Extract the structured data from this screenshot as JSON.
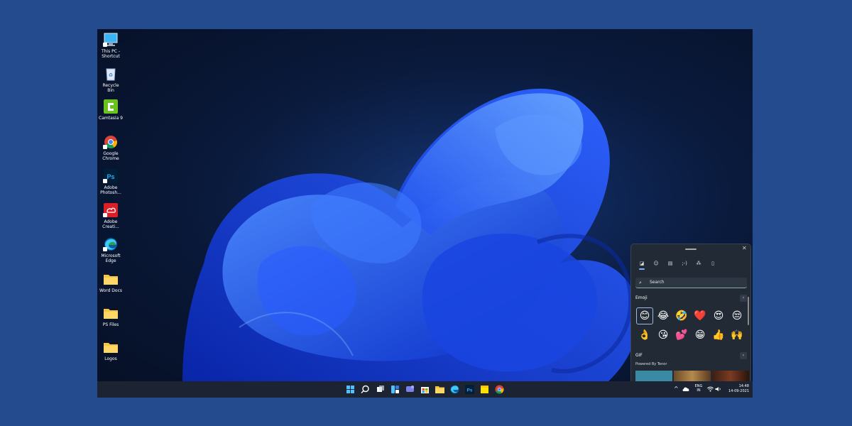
{
  "desktop": {
    "icons": [
      {
        "label": "This PC - Shortcut",
        "icon": "computer-icon"
      },
      {
        "label": "Recycle Bin",
        "icon": "recycle-bin-icon"
      },
      {
        "label": "Camtasia 9",
        "icon": "camtasia-icon"
      },
      {
        "label": "Google Chrome",
        "icon": "chrome-icon"
      },
      {
        "label": "Adobe Photosh...",
        "icon": "photoshop-icon"
      },
      {
        "label": "Adobe Creati...",
        "icon": "creative-cloud-icon"
      },
      {
        "label": "Microsoft Edge",
        "icon": "edge-icon"
      },
      {
        "label": "Word Docs",
        "icon": "folder-icon"
      },
      {
        "label": "PS Files",
        "icon": "folder-icon"
      },
      {
        "label": "Logos",
        "icon": "folder-icon"
      }
    ]
  },
  "emoji_panel": {
    "tabs": [
      "recently-used-icon",
      "emoji-icon",
      "gif-icon",
      "kaomoji-icon",
      "symbols-icon",
      "clipboard-icon"
    ],
    "search_placeholder": "Search",
    "emoji_section_title": "Emoji",
    "emojis_row1": [
      "😊",
      "😂",
      "🤣",
      "❤️",
      "😍",
      "😒"
    ],
    "emojis_row2": [
      "👌",
      "😘",
      "💕",
      "😁",
      "👍",
      "🙌"
    ],
    "gif_section_title": "GIF",
    "gif_powered_by": "Powered By Tenor"
  },
  "taskbar": {
    "apps": [
      "start-icon",
      "search-icon",
      "task-view-icon",
      "widgets-icon",
      "teams-chat-icon",
      "store-icon",
      "file-explorer-icon",
      "edge-icon",
      "photoshop-icon",
      "sticky-notes-icon",
      "chrome-icon"
    ],
    "tray": {
      "chevron": "^",
      "language_line1": "ENG",
      "language_line2": "IN",
      "time": "14:48",
      "date": "14-09-2021"
    }
  },
  "colors": {
    "outer_background": "#254b8f",
    "taskbar": "#1c2433",
    "panel": "#222a36",
    "accent": "#7fb2ff"
  }
}
